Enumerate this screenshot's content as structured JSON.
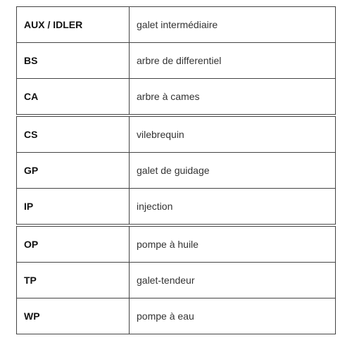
{
  "rows": [
    {
      "code": "AUX / IDLER",
      "desc": "galet intermédiaire"
    },
    {
      "code": "BS",
      "desc": "arbre de differentiel"
    },
    {
      "code": "CA",
      "desc": "arbre à cames"
    },
    {
      "code": "CS",
      "desc": "vilebrequin"
    },
    {
      "code": "GP",
      "desc": "galet de guidage"
    },
    {
      "code": "IP",
      "desc": "injection"
    },
    {
      "code": "OP",
      "desc": "pompe à huile"
    },
    {
      "code": "TP",
      "desc": "galet-tendeur"
    },
    {
      "code": "WP",
      "desc": "pompe à eau"
    }
  ]
}
